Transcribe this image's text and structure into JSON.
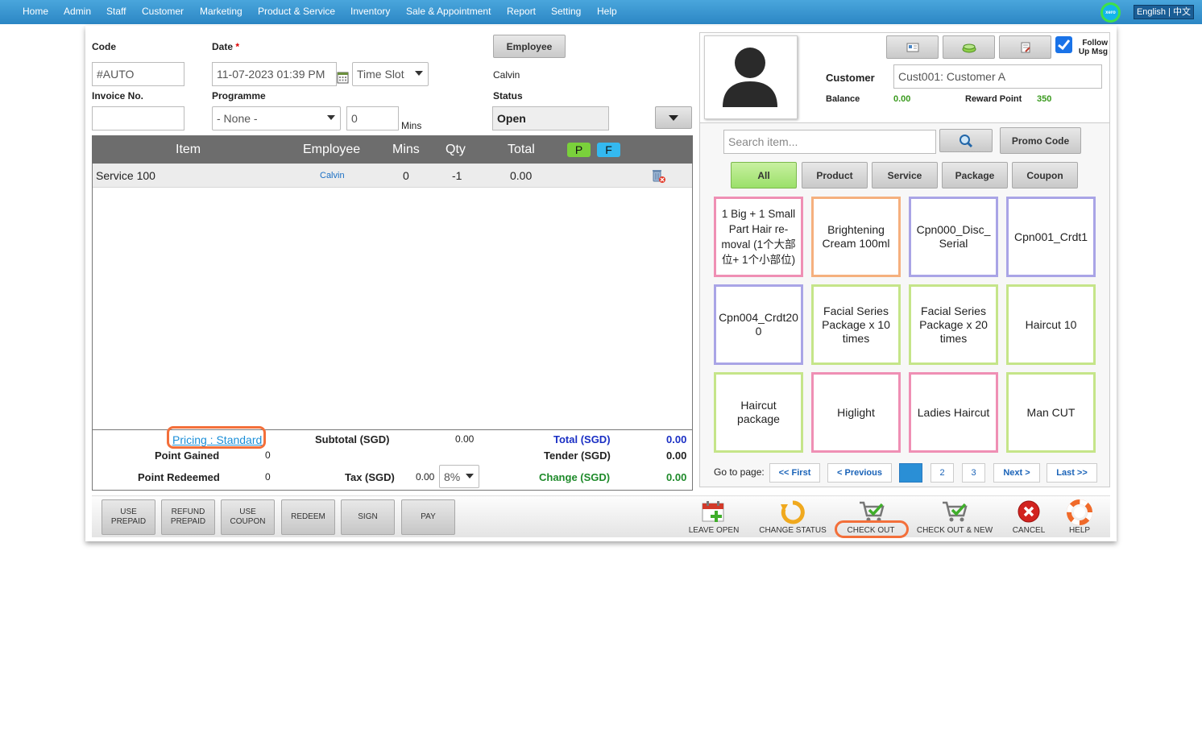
{
  "nav": {
    "items": [
      "Home",
      "Admin",
      "Staff",
      "Customer",
      "Marketing",
      "Product & Service",
      "Inventory",
      "Sale & Appointment",
      "Report",
      "Setting",
      "Help"
    ],
    "xero": "xero",
    "language": "English | 中文"
  },
  "form": {
    "code_label": "Code",
    "code_value": "#AUTO",
    "date_label": "Date",
    "date_required": "*",
    "date_value": "11-07-2023 01:39 PM",
    "timeslot_value": "Time Slot",
    "employee_button": "Employee",
    "employee_name": "Calvin",
    "invoice_label": "Invoice No.",
    "invoice_value": "",
    "programme_label": "Programme",
    "programme_value": "- None -",
    "mins_value": "0",
    "mins_label": "Mins",
    "status_label": "Status",
    "status_value": "Open"
  },
  "table": {
    "headers": {
      "item": "Item",
      "employee": "Employee",
      "mins": "Mins",
      "qty": "Qty",
      "total": "Total",
      "p": "P",
      "f": "F"
    },
    "rows": [
      {
        "item": "Service 100",
        "employee": "Calvin",
        "mins": "0",
        "qty": "-1",
        "total": "0.00"
      }
    ]
  },
  "totals": {
    "pricing_link": "Pricing : Standard",
    "point_gained_label": "Point Gained",
    "point_gained_value": "0",
    "point_redeemed_label": "Point Redeemed",
    "point_redeemed_value": "0",
    "subtotal_label": "Subtotal (SGD)",
    "subtotal_value": "0.00",
    "tax_label": "Tax (SGD)",
    "tax_value": "0.00",
    "tax_rate": "8%",
    "total_label": "Total (SGD)",
    "total_value": "0.00",
    "tender_label": "Tender (SGD)",
    "tender_value": "0.00",
    "change_label": "Change (SGD)",
    "change_value": "0.00"
  },
  "actions": {
    "use_prepaid": "USE PREPAID",
    "refund_prepaid": "REFUND PREPAID",
    "use_coupon": "USE COUPON",
    "redeem": "REDEEM",
    "sign": "SIGN",
    "pay": "PAY"
  },
  "tools": {
    "leave_open": "LEAVE OPEN",
    "change_status": "CHANGE STATUS",
    "check_out": "CHECK OUT",
    "check_out_new": "CHECK OUT & NEW",
    "cancel": "CANCEL",
    "help": "HELP"
  },
  "customer": {
    "follow_up_label": "Follow Up Msg",
    "customer_label": "Customer",
    "customer_value": "Cust001: Customer A",
    "balance_label": "Balance",
    "balance_value": "0.00",
    "reward_label": "Reward Point",
    "reward_value": "350"
  },
  "catalog": {
    "search_placeholder": "Search item...",
    "promo_button": "Promo Code",
    "filters": [
      "All",
      "Product",
      "Service",
      "Package",
      "Coupon"
    ],
    "tiles": [
      {
        "label": "1 Big + 1 Small Part Hair re-moval (1个大部位+ 1个小部位)",
        "color": "#ef8fb4"
      },
      {
        "label": "Brightening Cream 100ml",
        "color": "#f5b07e"
      },
      {
        "label": "Cpn000_Disc_Serial",
        "color": "#a9a4e6"
      },
      {
        "label": "Cpn001_Crdt1",
        "color": "#a9a4e6"
      },
      {
        "label": "Cpn004_Crdt200",
        "color": "#a9a4e6"
      },
      {
        "label": "Facial Series Package x 10 times",
        "color": "#c5e589"
      },
      {
        "label": "Facial Series Package x 20 times",
        "color": "#c5e589"
      },
      {
        "label": "Haircut 10",
        "color": "#c5e589"
      },
      {
        "label": "Haircut package",
        "color": "#c5e589"
      },
      {
        "label": "Higlight",
        "color": "#ef8fb4"
      },
      {
        "label": "Ladies Haircut",
        "color": "#ef8fb4"
      },
      {
        "label": "Man CUT",
        "color": "#c5e589"
      }
    ],
    "goto_label": "Go to page:",
    "first": "<< First",
    "previous": "< Previous",
    "pages": [
      "1",
      "2",
      "3"
    ],
    "next": "Next >",
    "last": "Last >>"
  }
}
